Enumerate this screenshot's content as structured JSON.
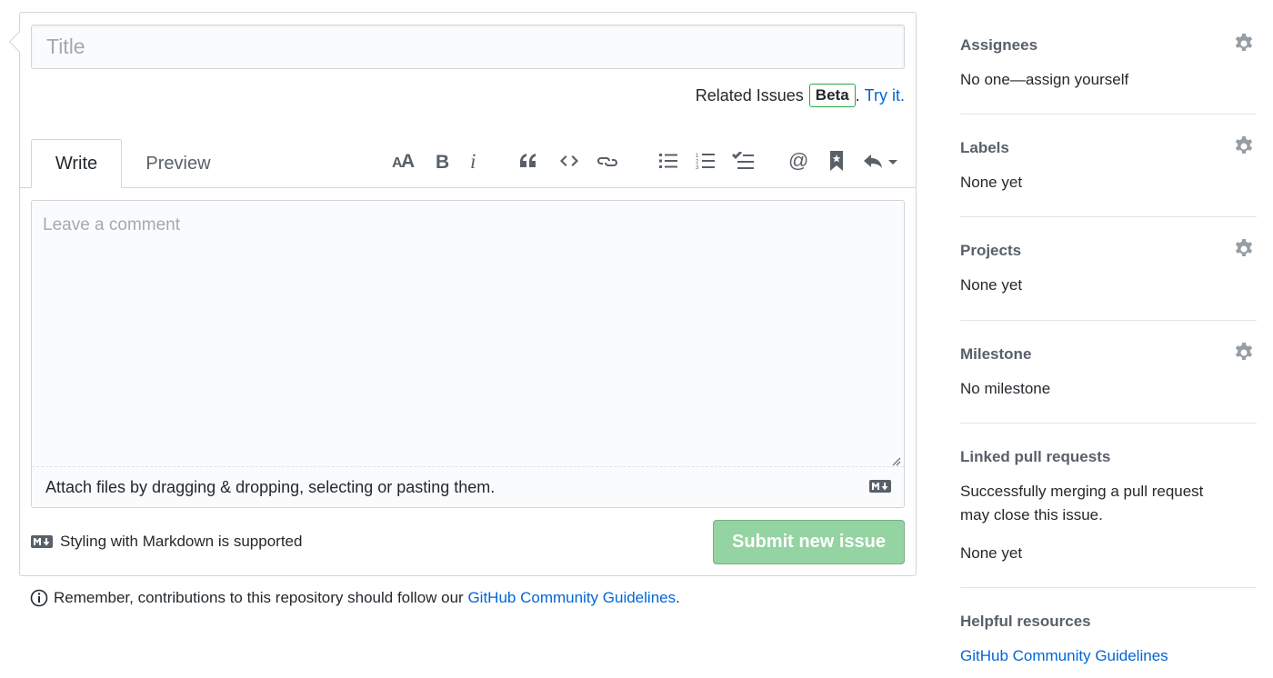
{
  "form": {
    "title_placeholder": "Title",
    "related_issues_label": "Related Issues",
    "beta_badge": "Beta",
    "period": ".",
    "try_it_link": "Try it.",
    "tabs": [
      {
        "label": "Write"
      },
      {
        "label": "Preview"
      }
    ],
    "toolbar_icons": [
      "text-size-icon",
      "bold-icon",
      "italic-icon",
      "quote-icon",
      "code-icon",
      "link-icon",
      "unordered-list-icon",
      "ordered-list-icon",
      "task-list-icon",
      "mention-icon",
      "saved-reply-icon",
      "reply-icon"
    ],
    "comment_placeholder": "Leave a comment",
    "attach_text": "Attach files by dragging & dropping, selecting or pasting them.",
    "markdown_note": "Styling with Markdown is supported",
    "submit_label": "Submit new issue",
    "remember_text": "Remember, contributions to this repository should follow our",
    "remember_link": "GitHub Community Guidelines",
    "remember_end": "."
  },
  "sidebar": {
    "assignees": {
      "title": "Assignees",
      "value": "No one—assign yourself"
    },
    "labels": {
      "title": "Labels",
      "value": "None yet"
    },
    "projects": {
      "title": "Projects",
      "value": "None yet"
    },
    "milestone": {
      "title": "Milestone",
      "value": "No milestone"
    },
    "linked_prs": {
      "title": "Linked pull requests",
      "line1": "Successfully merging a pull request",
      "line2": "may close this issue.",
      "value": "None yet"
    },
    "resources": {
      "title": "Helpful resources",
      "link": "GitHub Community Guidelines"
    }
  },
  "colors": {
    "link": "#0366d6",
    "submit_disabled_bg": "#94d3a2",
    "beta_border": "#28a745",
    "muted_text": "#586069",
    "border": "#d1d5da"
  }
}
